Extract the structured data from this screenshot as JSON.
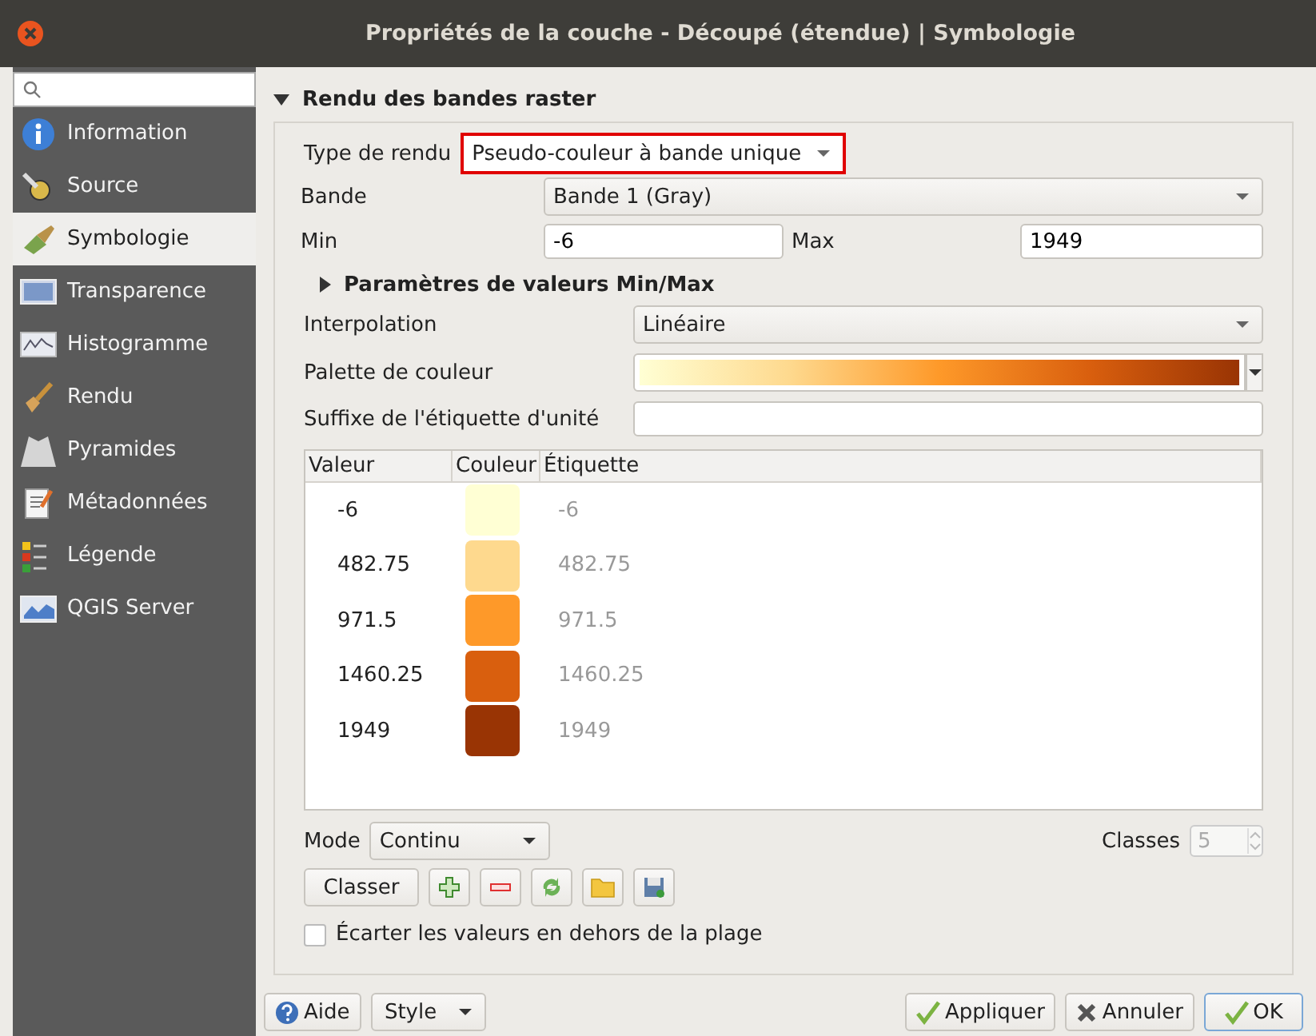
{
  "window": {
    "title": "Propriétés de la couche - Découpé (étendue) | Symbologie"
  },
  "sidebar": {
    "items": [
      {
        "label": "Information",
        "selected": false
      },
      {
        "label": "Source",
        "selected": false
      },
      {
        "label": "Symbologie",
        "selected": true
      },
      {
        "label": "Transparence",
        "selected": false
      },
      {
        "label": "Histogramme",
        "selected": false
      },
      {
        "label": "Rendu",
        "selected": false
      },
      {
        "label": "Pyramides",
        "selected": false
      },
      {
        "label": "Métadonnées",
        "selected": false
      },
      {
        "label": "Légende",
        "selected": false
      },
      {
        "label": "QGIS Server",
        "selected": false
      }
    ]
  },
  "section": {
    "title": "Rendu des bandes raster",
    "expanded": true
  },
  "render_type": {
    "label": "Type de rendu",
    "value": "Pseudo-couleur à bande unique"
  },
  "band": {
    "label": "Bande",
    "value": "Bande 1 (Gray)"
  },
  "min": {
    "label": "Min",
    "value": "-6"
  },
  "max": {
    "label": "Max",
    "value": "1949"
  },
  "minmax_section": {
    "title": "Paramètres de valeurs Min/Max",
    "expanded": false
  },
  "interpolation": {
    "label": "Interpolation",
    "value": "Linéaire"
  },
  "palette": {
    "label": "Palette de couleur"
  },
  "unit_suffix": {
    "label": "Suffixe de l'étiquette d'unité"
  },
  "table": {
    "columns": [
      "Valeur",
      "Couleur",
      "Étiquette"
    ],
    "rows": [
      {
        "value": "-6",
        "color": "#ffffd4",
        "label": "-6"
      },
      {
        "value": "482.75",
        "color": "#fed98e",
        "label": "482.75"
      },
      {
        "value": "971.5",
        "color": "#fe9929",
        "label": "971.5"
      },
      {
        "value": "1460.25",
        "color": "#d95f0e",
        "label": "1460.25"
      },
      {
        "value": "1949",
        "color": "#993404",
        "label": "1949"
      }
    ]
  },
  "mode": {
    "label": "Mode",
    "value": "Continu"
  },
  "classes": {
    "label": "Classes",
    "value": "5",
    "disabled": true
  },
  "classify_button": "Classer",
  "clip_checkbox": {
    "label": "Écarter les valeurs en dehors de la plage",
    "checked": false
  },
  "footer": {
    "help": "Aide",
    "style": "Style",
    "apply": "Appliquer",
    "cancel": "Annuler",
    "ok": "OK"
  }
}
